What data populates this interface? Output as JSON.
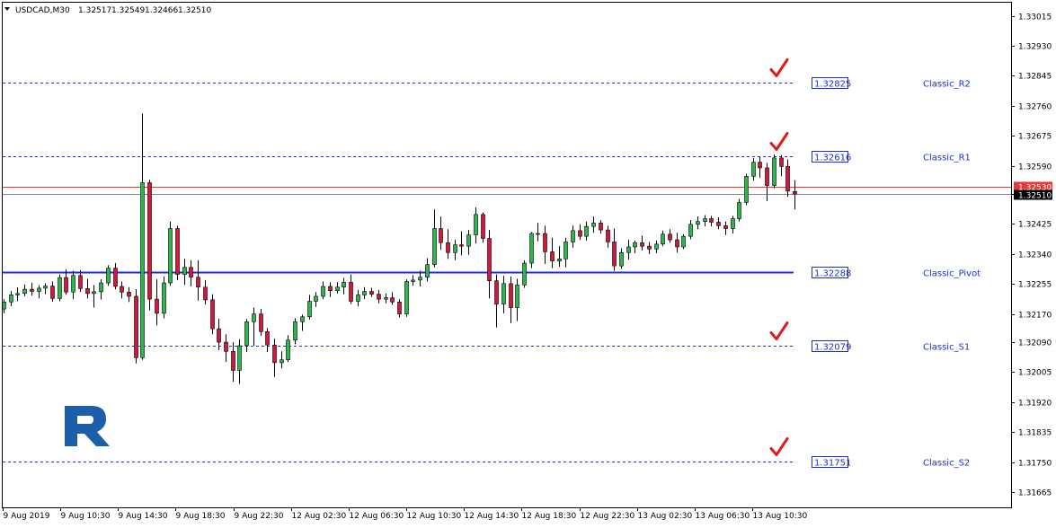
{
  "chart_data": {
    "type": "candlestick",
    "header": {
      "symbol": "USDCAD,M30",
      "open": "1.32517",
      "high": "1.32549",
      "low": "1.32466",
      "close": "1.32510"
    },
    "ylim": [
      1.31622,
      1.33052
    ],
    "y_ticks": [
      "1.33015",
      "1.32930",
      "1.32845",
      "1.32760",
      "1.32675",
      "1.32590",
      "1.32510",
      "1.32425",
      "1.32340",
      "1.32255",
      "1.32170",
      "1.32090",
      "1.32005",
      "1.31920",
      "1.31835",
      "1.31750",
      "1.31665"
    ],
    "x_ticks": [
      "9 Aug 2019",
      "9 Aug 10:30",
      "9 Aug 14:30",
      "9 Aug 18:30",
      "9 Aug 22:30",
      "12 Aug 02:30",
      "12 Aug 06:30",
      "12 Aug 10:30",
      "12 Aug 14:30",
      "12 Aug 18:30",
      "12 Aug 22:30",
      "13 Aug 02:30",
      "13 Aug 06:30",
      "13 Aug 10:30"
    ],
    "pivot_levels": [
      {
        "name": "Classic_R2",
        "value": "1.32825",
        "check": true
      },
      {
        "name": "Classic_R1",
        "value": "1.32616",
        "check": true
      },
      {
        "name": "Classic_Pivot",
        "value": "1.32288",
        "check": false,
        "solid": true
      },
      {
        "name": "Classic_S1",
        "value": "1.32079",
        "check": true
      },
      {
        "name": "Classic_S2",
        "value": "1.31751",
        "check": true
      }
    ],
    "ask_line": "1.32530",
    "bid_line": "1.32510",
    "colors": {
      "bull": "#2db74a",
      "bear": "#d4163a",
      "level": "#1a2fd6",
      "ask": "#e23a3a",
      "bid": "#888888",
      "check": "#e01b1b",
      "logo": "#1c5ea8"
    },
    "candles": [
      [
        1.32184,
        1.32212,
        1.32172,
        1.32204
      ],
      [
        1.32204,
        1.32235,
        1.32192,
        1.32224
      ],
      [
        1.32224,
        1.32245,
        1.32206,
        1.32228
      ],
      [
        1.32228,
        1.32254,
        1.3222,
        1.3224
      ],
      [
        1.3224,
        1.32258,
        1.32222,
        1.32234
      ],
      [
        1.32234,
        1.32251,
        1.32214,
        1.32243
      ],
      [
        1.32243,
        1.32257,
        1.32226,
        1.32249
      ],
      [
        1.32249,
        1.32262,
        1.32205,
        1.32214
      ],
      [
        1.32214,
        1.32282,
        1.32206,
        1.32273
      ],
      [
        1.32273,
        1.32296,
        1.32224,
        1.32232
      ],
      [
        1.32232,
        1.32292,
        1.32212,
        1.32279
      ],
      [
        1.32279,
        1.32294,
        1.32232,
        1.32242
      ],
      [
        1.32242,
        1.3227,
        1.32214,
        1.32228
      ],
      [
        1.32228,
        1.32252,
        1.32188,
        1.32233
      ],
      [
        1.32233,
        1.32268,
        1.32211,
        1.32258
      ],
      [
        1.32258,
        1.32308,
        1.3225,
        1.323
      ],
      [
        1.323,
        1.32314,
        1.3224,
        1.32248
      ],
      [
        1.32248,
        1.32262,
        1.32214,
        1.32232
      ],
      [
        1.32232,
        1.32246,
        1.32204,
        1.3222
      ],
      [
        1.3222,
        1.3224,
        1.3203,
        1.32046
      ],
      [
        1.32046,
        1.32738,
        1.3204,
        1.32542
      ],
      [
        1.32542,
        1.3255,
        1.3218,
        1.32212
      ],
      [
        1.32212,
        1.32268,
        1.32138,
        1.32172
      ],
      [
        1.32172,
        1.32276,
        1.32158,
        1.32258
      ],
      [
        1.32258,
        1.32432,
        1.3225,
        1.32412
      ],
      [
        1.32412,
        1.3242,
        1.32266,
        1.32282
      ],
      [
        1.32282,
        1.32326,
        1.32252,
        1.32302
      ],
      [
        1.32302,
        1.32322,
        1.32248,
        1.32274
      ],
      [
        1.32274,
        1.32322,
        1.32208,
        1.32246
      ],
      [
        1.32246,
        1.32266,
        1.32196,
        1.3221
      ],
      [
        1.3221,
        1.32226,
        1.32112,
        1.32128
      ],
      [
        1.32128,
        1.32156,
        1.32068,
        1.3209
      ],
      [
        1.3209,
        1.32112,
        1.32034,
        1.32064
      ],
      [
        1.32064,
        1.3209,
        1.31978,
        1.3201
      ],
      [
        1.3201,
        1.32098,
        1.31972,
        1.3208
      ],
      [
        1.3208,
        1.32156,
        1.32062,
        1.32148
      ],
      [
        1.32148,
        1.32188,
        1.3208,
        1.3217
      ],
      [
        1.3217,
        1.32184,
        1.32108,
        1.3212
      ],
      [
        1.3212,
        1.3213,
        1.32062,
        1.32082
      ],
      [
        1.32082,
        1.321,
        1.31992,
        1.32032
      ],
      [
        1.32032,
        1.32064,
        1.32016,
        1.3204
      ],
      [
        1.3204,
        1.3211,
        1.32034,
        1.32096
      ],
      [
        1.32096,
        1.32158,
        1.32084,
        1.32148
      ],
      [
        1.32148,
        1.32168,
        1.32122,
        1.32162
      ],
      [
        1.32162,
        1.32224,
        1.32154,
        1.32206
      ],
      [
        1.32206,
        1.32232,
        1.3219,
        1.3222
      ],
      [
        1.3222,
        1.32262,
        1.32212,
        1.32248
      ],
      [
        1.32248,
        1.3226,
        1.32218,
        1.32236
      ],
      [
        1.32236,
        1.3226,
        1.32228,
        1.32246
      ],
      [
        1.32246,
        1.32272,
        1.32226,
        1.3226
      ],
      [
        1.3226,
        1.32282,
        1.32198,
        1.32206
      ],
      [
        1.32206,
        1.32238,
        1.32192,
        1.32224
      ],
      [
        1.32224,
        1.32246,
        1.32212,
        1.32234
      ],
      [
        1.32234,
        1.32244,
        1.32218,
        1.32226
      ],
      [
        1.32226,
        1.32238,
        1.322,
        1.32212
      ],
      [
        1.32212,
        1.32228,
        1.322,
        1.32216
      ],
      [
        1.32216,
        1.32232,
        1.32196,
        1.32204
      ],
      [
        1.32204,
        1.32212,
        1.3216,
        1.3217
      ],
      [
        1.3217,
        1.32268,
        1.32162,
        1.32262
      ],
      [
        1.32262,
        1.3228,
        1.3225,
        1.32266
      ],
      [
        1.32266,
        1.32292,
        1.32248,
        1.32274
      ],
      [
        1.32274,
        1.32328,
        1.32262,
        1.3231
      ],
      [
        1.3231,
        1.32466,
        1.32302,
        1.32412
      ],
      [
        1.32412,
        1.32446,
        1.32352,
        1.32372
      ],
      [
        1.32372,
        1.3241,
        1.32326,
        1.32344
      ],
      [
        1.32344,
        1.3238,
        1.32322,
        1.32366
      ],
      [
        1.32366,
        1.32404,
        1.32336,
        1.32362
      ],
      [
        1.32362,
        1.32408,
        1.32338,
        1.32394
      ],
      [
        1.32394,
        1.32472,
        1.3237,
        1.32452
      ],
      [
        1.32452,
        1.32458,
        1.32372,
        1.32384
      ],
      [
        1.32384,
        1.32408,
        1.32214,
        1.32264
      ],
      [
        1.32264,
        1.32282,
        1.32132,
        1.32198
      ],
      [
        1.32198,
        1.32278,
        1.32172,
        1.32256
      ],
      [
        1.32256,
        1.32276,
        1.32144,
        1.32188
      ],
      [
        1.32188,
        1.3227,
        1.3215,
        1.32252
      ],
      [
        1.32252,
        1.32322,
        1.32244,
        1.32314
      ],
      [
        1.32314,
        1.32402,
        1.323,
        1.32398
      ],
      [
        1.32398,
        1.32428,
        1.32376,
        1.32398
      ],
      [
        1.32398,
        1.3242,
        1.32312,
        1.32346
      ],
      [
        1.32346,
        1.32386,
        1.323,
        1.3232
      ],
      [
        1.3232,
        1.32362,
        1.32304,
        1.32326
      ],
      [
        1.32326,
        1.32386,
        1.32302,
        1.32374
      ],
      [
        1.32374,
        1.3242,
        1.32358,
        1.32406
      ],
      [
        1.32406,
        1.32424,
        1.3238,
        1.3239
      ],
      [
        1.3239,
        1.32432,
        1.32378,
        1.32418
      ],
      [
        1.32418,
        1.32446,
        1.324,
        1.32428
      ],
      [
        1.32428,
        1.32436,
        1.32398,
        1.32408
      ],
      [
        1.32408,
        1.3242,
        1.32358,
        1.32374
      ],
      [
        1.32374,
        1.32412,
        1.32292,
        1.32306
      ],
      [
        1.32306,
        1.32356,
        1.32298,
        1.32344
      ],
      [
        1.32344,
        1.3238,
        1.32324,
        1.3236
      ],
      [
        1.3236,
        1.32378,
        1.32342,
        1.32372
      ],
      [
        1.32372,
        1.32392,
        1.3235,
        1.32362
      ],
      [
        1.32362,
        1.32374,
        1.3234,
        1.32354
      ],
      [
        1.32354,
        1.32378,
        1.32342,
        1.32368
      ],
      [
        1.32368,
        1.32406,
        1.32362,
        1.32396
      ],
      [
        1.32396,
        1.3241,
        1.32372,
        1.3238
      ],
      [
        1.3238,
        1.324,
        1.32344,
        1.3236
      ],
      [
        1.3236,
        1.32396,
        1.32354,
        1.3239
      ],
      [
        1.3239,
        1.32436,
        1.32382,
        1.32424
      ],
      [
        1.32424,
        1.32446,
        1.3241,
        1.32432
      ],
      [
        1.32432,
        1.3245,
        1.32418,
        1.3244
      ],
      [
        1.3244,
        1.32448,
        1.32418,
        1.3243
      ],
      [
        1.3243,
        1.32444,
        1.3241,
        1.3242
      ],
      [
        1.3242,
        1.32432,
        1.32394,
        1.32412
      ],
      [
        1.32412,
        1.32448,
        1.32398,
        1.3244
      ],
      [
        1.3244,
        1.32496,
        1.32432,
        1.32486
      ],
      [
        1.32486,
        1.32568,
        1.32478,
        1.3256
      ],
      [
        1.3256,
        1.32612,
        1.32548,
        1.326
      ],
      [
        1.326,
        1.32616,
        1.32556,
        1.32584
      ],
      [
        1.32584,
        1.32598,
        1.3249,
        1.32534
      ],
      [
        1.32534,
        1.32622,
        1.32526,
        1.32612
      ],
      [
        1.32612,
        1.3262,
        1.3256,
        1.32588
      ],
      [
        1.32588,
        1.32608,
        1.32502,
        1.32518
      ],
      [
        1.32517,
        1.32549,
        1.32466,
        1.3251
      ]
    ]
  }
}
